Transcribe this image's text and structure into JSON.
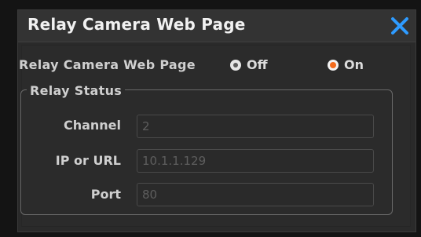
{
  "dialog": {
    "title": "Relay Camera Web Page",
    "close_icon": "close-icon",
    "accent_color": "#2e9bff"
  },
  "toggle": {
    "label": "Relay Camera Web Page",
    "options": [
      {
        "label": "Off",
        "selected": false
      },
      {
        "label": "On",
        "selected": true
      }
    ],
    "selected_color": "#f26a1b"
  },
  "relay_status": {
    "legend": "Relay Status",
    "fields": [
      {
        "label": "Channel",
        "value": "2"
      },
      {
        "label": "IP or URL",
        "value": "10.1.1.129"
      },
      {
        "label": "Port",
        "value": "80"
      }
    ]
  }
}
